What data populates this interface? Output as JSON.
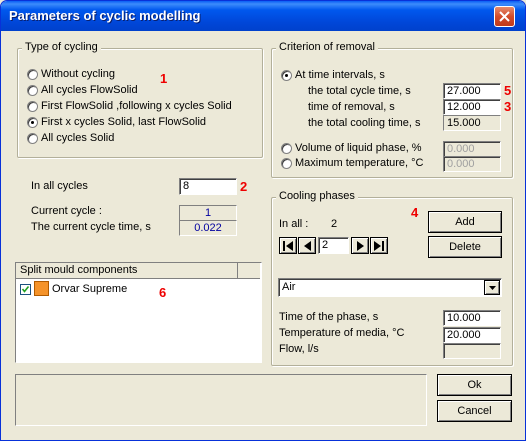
{
  "window": {
    "title": "Parameters of cyclic modelling"
  },
  "type_of_cycling": {
    "label": "Type of cycling",
    "options": [
      {
        "label": "Without cycling",
        "checked": false
      },
      {
        "label": "All cycles FlowSolid",
        "checked": false
      },
      {
        "label": "First FlowSolid ,following x cycles Solid",
        "checked": false
      },
      {
        "label": "First x cycles Solid, last FlowSolid",
        "checked": true
      },
      {
        "label": "All cycles Solid",
        "checked": false
      }
    ]
  },
  "cycles": {
    "in_all_label": "In all cycles",
    "in_all_value": "8",
    "current_cycle_label": "Current cycle :",
    "current_cycle_value": "1",
    "current_time_label": "The current cycle time, s",
    "current_time_value": "0.022"
  },
  "split_mould": {
    "header": "Split mould components",
    "items": [
      {
        "label": "Orvar Supreme",
        "checked": true,
        "color": "#f5932a"
      }
    ]
  },
  "criterion": {
    "label": "Criterion of removal",
    "at_time_label": "At time intervals, s",
    "total_cycle_label": "the total cycle time, s",
    "total_cycle_value": "27.000",
    "removal_label": "time of removal, s",
    "removal_value": "12.000",
    "cooling_label": "the total cooling time, s",
    "cooling_value": "15.000",
    "volume_label": "Volume of liquid phase, %",
    "volume_value": "0.000",
    "max_temp_label": "Maximum temperature, °C",
    "max_temp_value": "0.000"
  },
  "cooling_phases": {
    "label": "Cooling phases",
    "in_all_label": "In all :",
    "in_all_value": "2",
    "add_label": "Add",
    "delete_label": "Delete",
    "phase_index": "2",
    "medium": "Air",
    "phase_time_label": "Time of the phase, s",
    "phase_time_value": "10.000",
    "media_temp_label": "Temperature of media, °C",
    "media_temp_value": "20.000",
    "flow_label": "Flow, l/s",
    "flow_value": ""
  },
  "buttons": {
    "ok": "Ok",
    "cancel": "Cancel"
  },
  "markers": {
    "m1": "1",
    "m2": "2",
    "m3": "3",
    "m4": "4",
    "m5": "5",
    "m6": "6"
  },
  "colors": {
    "marker": "#e00000",
    "title_bar": "#0054e3",
    "value_text": "#0000a0"
  }
}
